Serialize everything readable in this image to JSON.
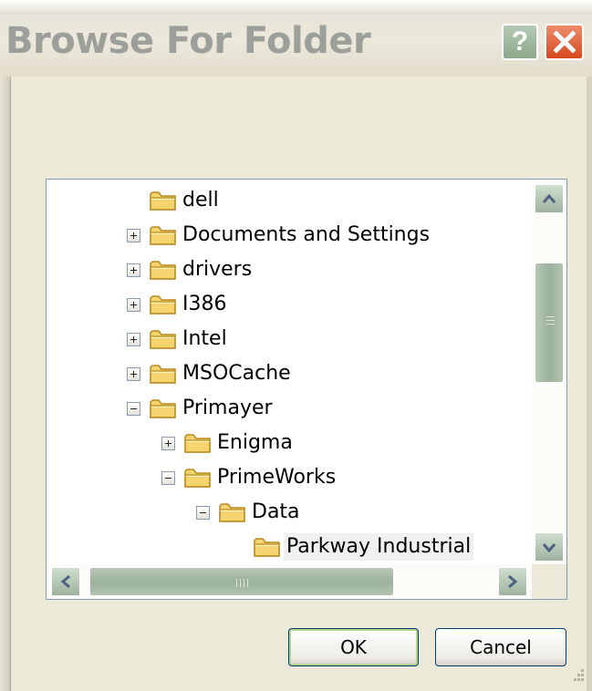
{
  "window": {
    "title": "Browse For Folder",
    "help_label": "?",
    "close_icon": "close-icon"
  },
  "tree": {
    "items": [
      {
        "label": "dell",
        "expander": "none"
      },
      {
        "label": "Documents and Settings",
        "expander": "plus"
      },
      {
        "label": "drivers",
        "expander": "plus"
      },
      {
        "label": "I386",
        "expander": "plus"
      },
      {
        "label": "Intel",
        "expander": "plus"
      },
      {
        "label": "MSOCache",
        "expander": "plus"
      },
      {
        "label": "Primayer",
        "expander": "minus"
      },
      {
        "label": "Enigma",
        "expander": "plus"
      },
      {
        "label": "PrimeWorks",
        "expander": "minus"
      },
      {
        "label": "Data",
        "expander": "minus"
      },
      {
        "label": "Parkway Industrial",
        "expander": "none",
        "selected": true
      }
    ]
  },
  "buttons": {
    "ok": "OK",
    "cancel": "Cancel"
  },
  "colors": {
    "folder_fill": "#f5d36e",
    "folder_stroke": "#b98a1c",
    "scrollbar": "#9bb19a",
    "close": "#d6481e"
  }
}
